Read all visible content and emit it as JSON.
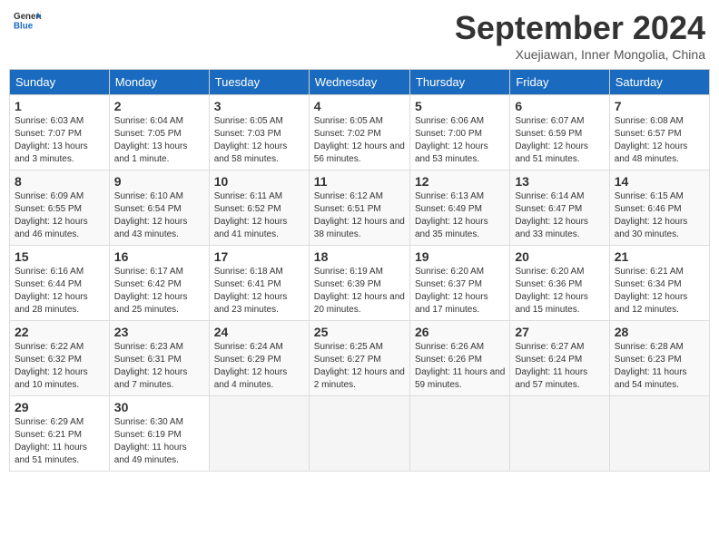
{
  "logo": {
    "general": "General",
    "blue": "Blue"
  },
  "header": {
    "month": "September 2024",
    "location": "Xuejiawan, Inner Mongolia, China"
  },
  "days_of_week": [
    "Sunday",
    "Monday",
    "Tuesday",
    "Wednesday",
    "Thursday",
    "Friday",
    "Saturday"
  ],
  "weeks": [
    [
      {
        "day": "1",
        "info": "Sunrise: 6:03 AM\nSunset: 7:07 PM\nDaylight: 13 hours and 3 minutes."
      },
      {
        "day": "2",
        "info": "Sunrise: 6:04 AM\nSunset: 7:05 PM\nDaylight: 13 hours and 1 minute."
      },
      {
        "day": "3",
        "info": "Sunrise: 6:05 AM\nSunset: 7:03 PM\nDaylight: 12 hours and 58 minutes."
      },
      {
        "day": "4",
        "info": "Sunrise: 6:05 AM\nSunset: 7:02 PM\nDaylight: 12 hours and 56 minutes."
      },
      {
        "day": "5",
        "info": "Sunrise: 6:06 AM\nSunset: 7:00 PM\nDaylight: 12 hours and 53 minutes."
      },
      {
        "day": "6",
        "info": "Sunrise: 6:07 AM\nSunset: 6:59 PM\nDaylight: 12 hours and 51 minutes."
      },
      {
        "day": "7",
        "info": "Sunrise: 6:08 AM\nSunset: 6:57 PM\nDaylight: 12 hours and 48 minutes."
      }
    ],
    [
      {
        "day": "8",
        "info": "Sunrise: 6:09 AM\nSunset: 6:55 PM\nDaylight: 12 hours and 46 minutes."
      },
      {
        "day": "9",
        "info": "Sunrise: 6:10 AM\nSunset: 6:54 PM\nDaylight: 12 hours and 43 minutes."
      },
      {
        "day": "10",
        "info": "Sunrise: 6:11 AM\nSunset: 6:52 PM\nDaylight: 12 hours and 41 minutes."
      },
      {
        "day": "11",
        "info": "Sunrise: 6:12 AM\nSunset: 6:51 PM\nDaylight: 12 hours and 38 minutes."
      },
      {
        "day": "12",
        "info": "Sunrise: 6:13 AM\nSunset: 6:49 PM\nDaylight: 12 hours and 35 minutes."
      },
      {
        "day": "13",
        "info": "Sunrise: 6:14 AM\nSunset: 6:47 PM\nDaylight: 12 hours and 33 minutes."
      },
      {
        "day": "14",
        "info": "Sunrise: 6:15 AM\nSunset: 6:46 PM\nDaylight: 12 hours and 30 minutes."
      }
    ],
    [
      {
        "day": "15",
        "info": "Sunrise: 6:16 AM\nSunset: 6:44 PM\nDaylight: 12 hours and 28 minutes."
      },
      {
        "day": "16",
        "info": "Sunrise: 6:17 AM\nSunset: 6:42 PM\nDaylight: 12 hours and 25 minutes."
      },
      {
        "day": "17",
        "info": "Sunrise: 6:18 AM\nSunset: 6:41 PM\nDaylight: 12 hours and 23 minutes."
      },
      {
        "day": "18",
        "info": "Sunrise: 6:19 AM\nSunset: 6:39 PM\nDaylight: 12 hours and 20 minutes."
      },
      {
        "day": "19",
        "info": "Sunrise: 6:20 AM\nSunset: 6:37 PM\nDaylight: 12 hours and 17 minutes."
      },
      {
        "day": "20",
        "info": "Sunrise: 6:20 AM\nSunset: 6:36 PM\nDaylight: 12 hours and 15 minutes."
      },
      {
        "day": "21",
        "info": "Sunrise: 6:21 AM\nSunset: 6:34 PM\nDaylight: 12 hours and 12 minutes."
      }
    ],
    [
      {
        "day": "22",
        "info": "Sunrise: 6:22 AM\nSunset: 6:32 PM\nDaylight: 12 hours and 10 minutes."
      },
      {
        "day": "23",
        "info": "Sunrise: 6:23 AM\nSunset: 6:31 PM\nDaylight: 12 hours and 7 minutes."
      },
      {
        "day": "24",
        "info": "Sunrise: 6:24 AM\nSunset: 6:29 PM\nDaylight: 12 hours and 4 minutes."
      },
      {
        "day": "25",
        "info": "Sunrise: 6:25 AM\nSunset: 6:27 PM\nDaylight: 12 hours and 2 minutes."
      },
      {
        "day": "26",
        "info": "Sunrise: 6:26 AM\nSunset: 6:26 PM\nDaylight: 11 hours and 59 minutes."
      },
      {
        "day": "27",
        "info": "Sunrise: 6:27 AM\nSunset: 6:24 PM\nDaylight: 11 hours and 57 minutes."
      },
      {
        "day": "28",
        "info": "Sunrise: 6:28 AM\nSunset: 6:23 PM\nDaylight: 11 hours and 54 minutes."
      }
    ],
    [
      {
        "day": "29",
        "info": "Sunrise: 6:29 AM\nSunset: 6:21 PM\nDaylight: 11 hours and 51 minutes."
      },
      {
        "day": "30",
        "info": "Sunrise: 6:30 AM\nSunset: 6:19 PM\nDaylight: 11 hours and 49 minutes."
      },
      {
        "day": "",
        "info": ""
      },
      {
        "day": "",
        "info": ""
      },
      {
        "day": "",
        "info": ""
      },
      {
        "day": "",
        "info": ""
      },
      {
        "day": "",
        "info": ""
      }
    ]
  ]
}
